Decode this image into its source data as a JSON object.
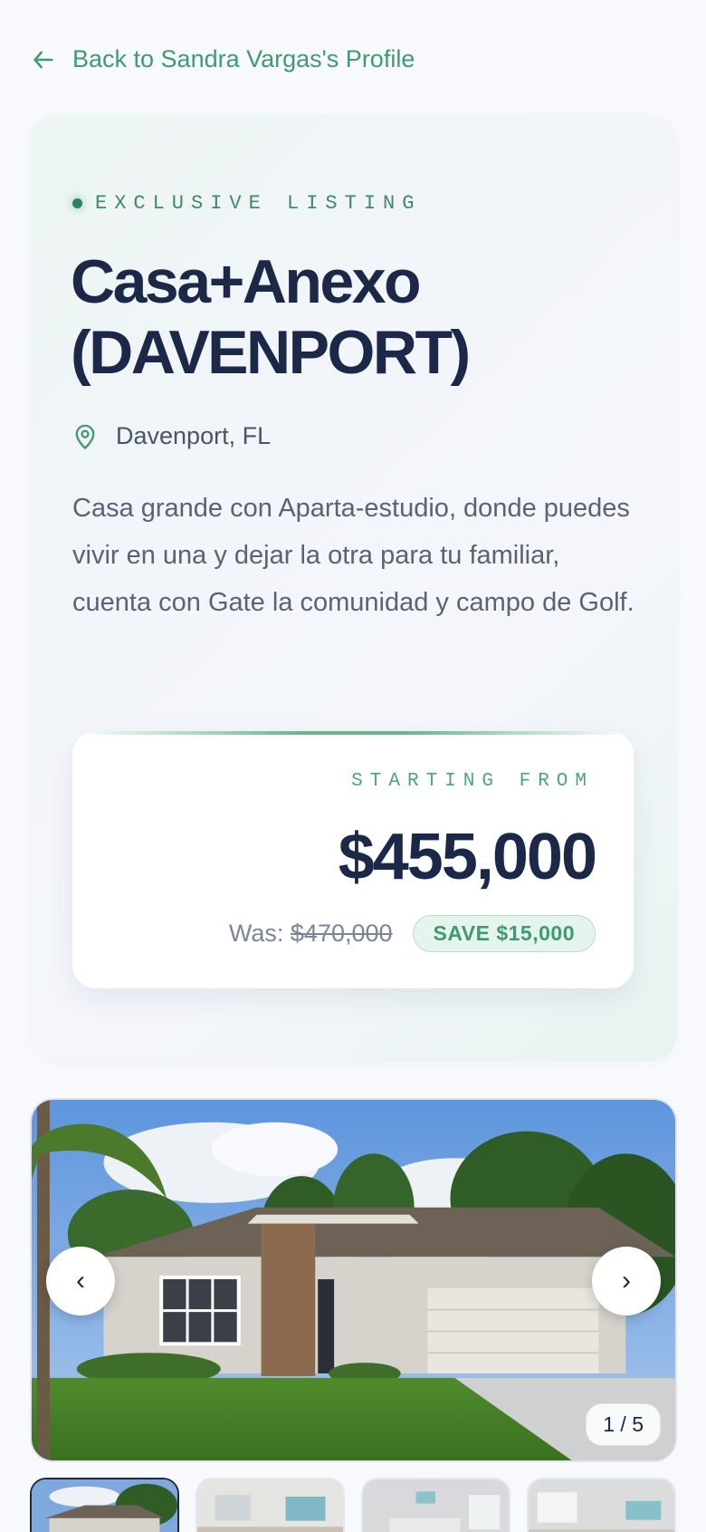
{
  "back_link": {
    "label": "Back to Sandra Vargas's Profile"
  },
  "listing": {
    "badge": "EXCLUSIVE LISTING",
    "title": "Casa+Anexo (DAVENPORT)",
    "location": "Davenport, FL",
    "description": "Casa grande con Aparta-estudio, donde puedes vivir en una y dejar la otra para tu familiar, cuenta con Gate la comunidad y campo de Golf."
  },
  "pricing": {
    "label": "STARTING FROM",
    "price": "$455,000",
    "was_label": "Was:",
    "was_price": "$470,000",
    "savings": "SAVE $15,000"
  },
  "gallery": {
    "counter": "1 / 5",
    "prev_icon": "chevron-left-icon",
    "next_icon": "chevron-right-icon",
    "prev_glyph": "‹",
    "next_glyph": "›"
  },
  "colors": {
    "accent": "#3f9a72",
    "navy": "#1c2848",
    "text_muted": "#5a6275"
  }
}
